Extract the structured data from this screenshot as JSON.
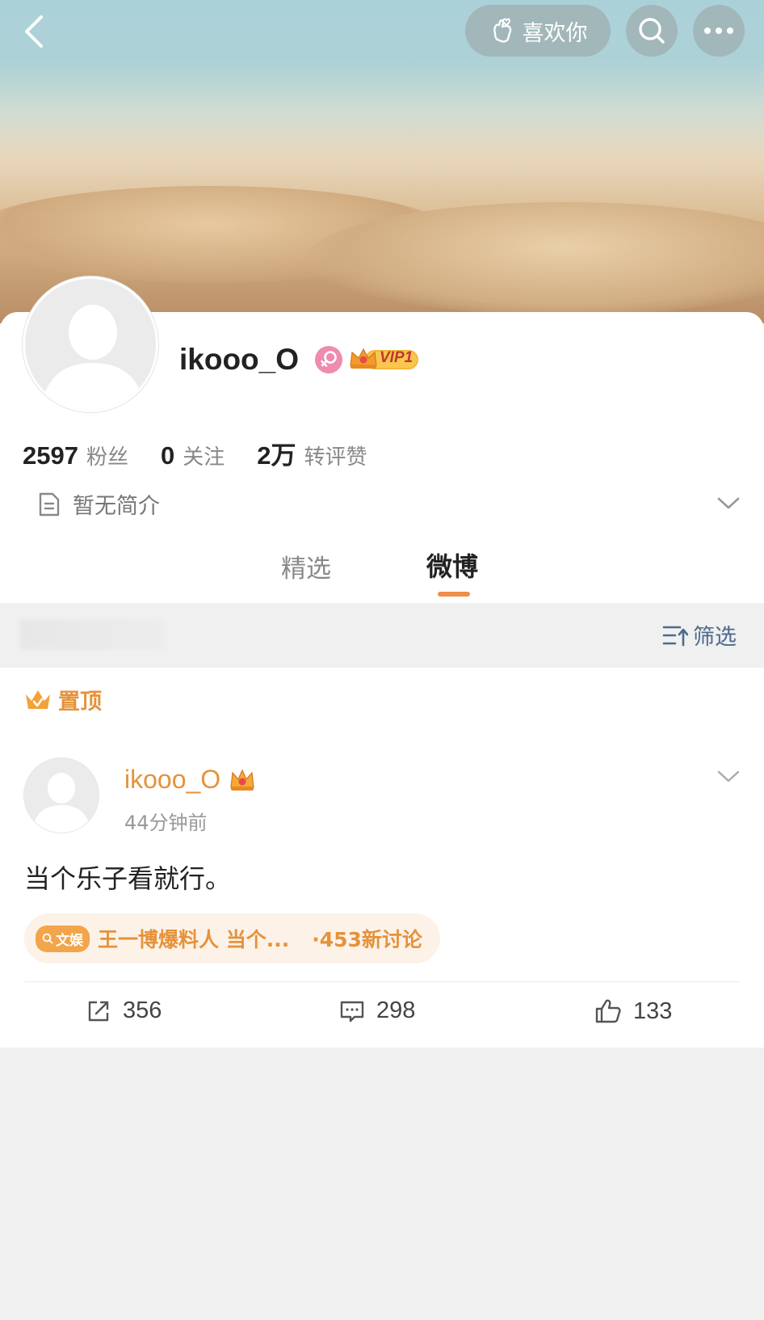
{
  "header": {
    "like_label": "喜欢你"
  },
  "profile": {
    "username": "ikooo_O",
    "vip_label": "VIP1",
    "stats": [
      {
        "value": "2597",
        "label": "粉丝"
      },
      {
        "value": "0",
        "label": "关注"
      },
      {
        "value": "2万",
        "label": "转评赞"
      }
    ],
    "bio": "暂无简介"
  },
  "tabs": [
    {
      "label": "精选",
      "active": false
    },
    {
      "label": "微博",
      "active": true
    }
  ],
  "filter": {
    "label": "筛选"
  },
  "post": {
    "pinned_label": "置顶",
    "username": "ikooo_O",
    "time": "44分钟前",
    "text": "当个乐子看就行。",
    "topic": {
      "tag": "文娱",
      "title": "王一博爆料人 当个...",
      "count": "·453新讨论"
    },
    "actions": {
      "reposts": "356",
      "comments": "298",
      "likes": "133"
    }
  },
  "colors": {
    "accent": "#f08d49",
    "orange_text": "#e5923b",
    "filter_blue": "#4d6a8e",
    "female_pink": "#f08bb0"
  },
  "icons": [
    "back-icon",
    "hand-heart-icon",
    "search-icon",
    "more-icon",
    "female-icon",
    "vip-crown-icon",
    "document-icon",
    "chevron-down-icon",
    "filter-icon",
    "crown-icon",
    "repost-icon",
    "comment-icon",
    "thumbs-up-icon"
  ]
}
